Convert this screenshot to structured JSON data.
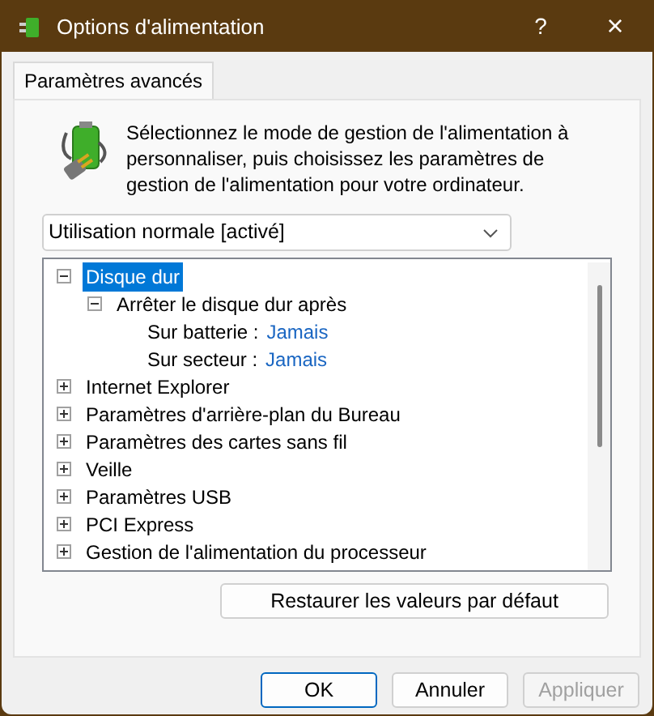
{
  "window": {
    "title": "Options d'alimentation",
    "help": "?",
    "close": "×"
  },
  "tabs": [
    {
      "label": "Paramètres avancés",
      "selected": true
    }
  ],
  "description": "Sélectionnez le mode de gestion de l'alimentation à personnaliser, puis choisissez les paramètres de gestion de l'alimentation pour votre ordinateur.",
  "plan_select": {
    "value": "Utilisation normale [activé]"
  },
  "tree": [
    {
      "label": "Disque dur",
      "expanded": true,
      "selected": true,
      "children": [
        {
          "label": "Arrêter le disque dur après",
          "expanded": true,
          "selected": false,
          "children": [
            {
              "label": "Sur batterie :",
              "value": "Jamais",
              "selected": false
            },
            {
              "label": "Sur secteur :",
              "value": "Jamais",
              "selected": false
            }
          ]
        }
      ]
    },
    {
      "label": "Internet Explorer",
      "expanded": false,
      "selected": false
    },
    {
      "label": "Paramètres d'arrière-plan du Bureau",
      "expanded": false,
      "selected": false
    },
    {
      "label": "Paramètres des cartes sans fil",
      "expanded": false,
      "selected": false
    },
    {
      "label": "Veille",
      "expanded": false,
      "selected": false
    },
    {
      "label": "Paramètres USB",
      "expanded": false,
      "selected": false
    },
    {
      "label": "PCI Express",
      "expanded": false,
      "selected": false
    },
    {
      "label": "Gestion de l'alimentation du processeur",
      "expanded": false,
      "selected": false
    }
  ],
  "restore_button": "Restaurer les valeurs par défaut",
  "buttons": [
    {
      "label": "OK",
      "default": true,
      "disabled": false
    },
    {
      "label": "Annuler",
      "default": false,
      "disabled": false
    },
    {
      "label": "Appliquer",
      "default": false,
      "disabled": true
    }
  ]
}
